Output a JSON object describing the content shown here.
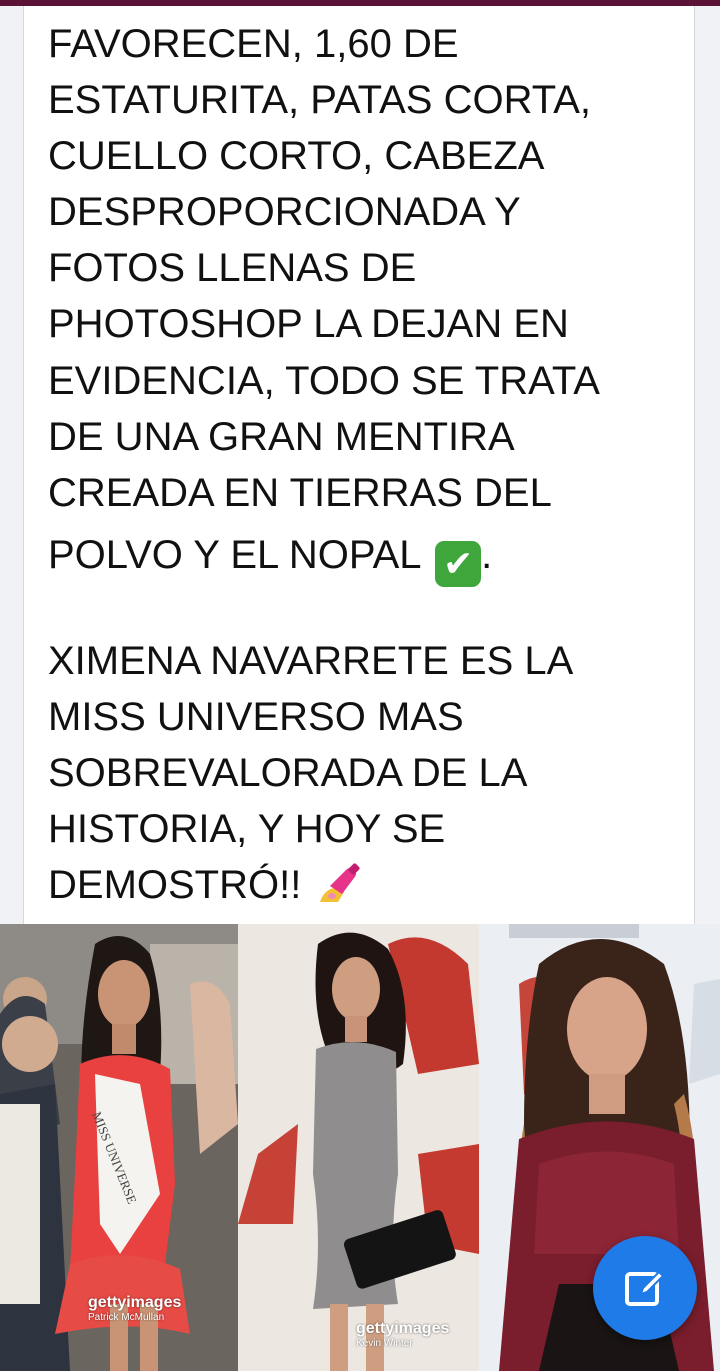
{
  "post": {
    "lines": [
      "FAVORECEN, 1,60 DE",
      "ESTATURITA, PATAS CORTA,",
      "CUELLO CORTO, CABEZA",
      "DESPROPORCIONADA Y",
      "FOTOS LLENAS DE",
      "PHOTOSHOP LA DEJAN EN",
      "EVIDENCIA, TODO SE TRATA",
      "DE UNA GRAN MENTIRA",
      "CREADA EN TIERRAS DEL",
      "POLVO Y EL NOPAL",
      "",
      "XIMENA NAVARRETE ES LA",
      "MISS UNIVERSO MAS",
      "SOBREVALORADA DE LA",
      "HISTORIA, Y HOY SE",
      "DEMOSTRÓ!!"
    ],
    "line10_suffix": ".",
    "check_emoji": "✔",
    "emoji_names": [
      "check-mark-button-emoji",
      "nail-polish-emoji"
    ]
  },
  "photos": [
    {
      "alt": "photo-left",
      "sash_text": "MISS UNIVERSE",
      "watermark_brand": "gettyimages",
      "watermark_credit": "Patrick McMullan"
    },
    {
      "alt": "photo-middle",
      "watermark_brand": "gettyimages",
      "watermark_credit": "Kevin Winter"
    },
    {
      "alt": "photo-right"
    }
  ],
  "fab": {
    "icon": "edit-icon",
    "color": "#1e7be8"
  },
  "colors": {
    "top_bar": "#5a1236",
    "background": "#f0f2f5",
    "text": "#111111"
  }
}
